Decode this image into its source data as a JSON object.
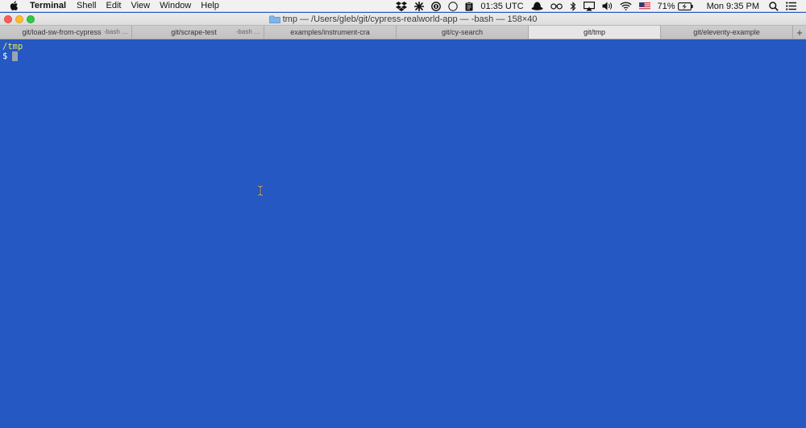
{
  "menubar": {
    "app_name": "Terminal",
    "items": [
      "Shell",
      "Edit",
      "View",
      "Window",
      "Help"
    ],
    "status": {
      "time_utc": "01:35 UTC",
      "battery": "71%",
      "clock": "Mon 9:35 PM",
      "icons": [
        "dropbox-icon",
        "pinwheel-icon",
        "onepassword-icon",
        "circle-icon",
        "clipboard-icon",
        "hat-icon",
        "glasses-icon",
        "bluetooth-icon",
        "airplay-icon",
        "volume-icon",
        "wifi-icon",
        "flag-icon",
        "battery-icon",
        "search-icon",
        "list-icon"
      ]
    }
  },
  "window": {
    "title": "tmp — /Users/gleb/git/cypress-realworld-app — -bash — 158×40"
  },
  "tabs": [
    {
      "label": "git/load-sw-from-cypress",
      "sub": "-bash …",
      "active": false
    },
    {
      "label": "git/scrape-test",
      "sub": "-bash …",
      "active": false
    },
    {
      "label": "examples/instrument-cra",
      "sub": "",
      "active": false
    },
    {
      "label": "git/cy-search",
      "sub": "",
      "active": false
    },
    {
      "label": "git/tmp",
      "sub": "",
      "active": true
    },
    {
      "label": "git/eleventy-example",
      "sub": "",
      "active": false
    }
  ],
  "tab_add_label": "+",
  "terminal": {
    "cwd": "/tmp",
    "prompt": "$",
    "colors": {
      "background": "#2558c3",
      "cwd": "#f2e84b",
      "text": "#ffffff"
    }
  }
}
